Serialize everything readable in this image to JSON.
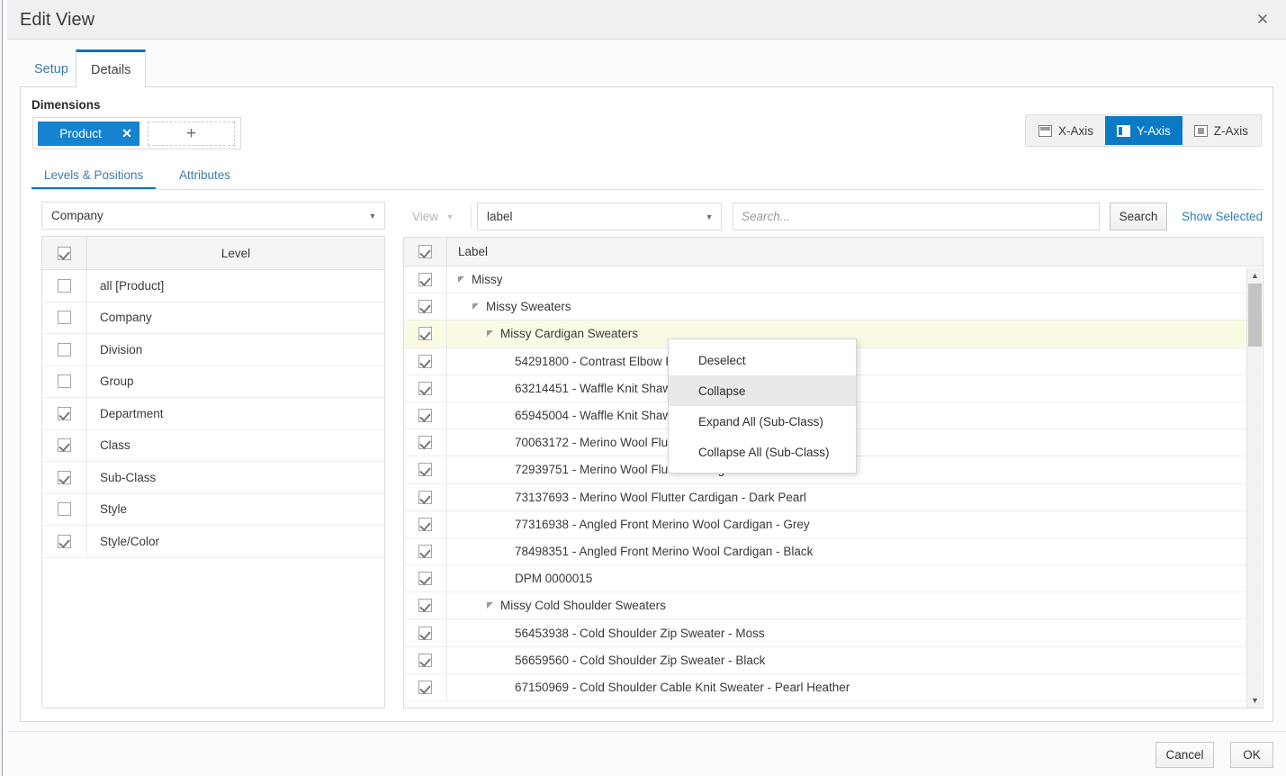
{
  "window": {
    "title": "Edit View",
    "close_icon": "close-icon"
  },
  "tabs": [
    {
      "label": "Setup",
      "active": false
    },
    {
      "label": "Details",
      "active": true
    }
  ],
  "dimensions": {
    "heading": "Dimensions",
    "pill": {
      "label": "Product",
      "remove_icon": "close-icon"
    },
    "add_icon": "plus-icon"
  },
  "axis_buttons": [
    {
      "label": "X-Axis",
      "icon": "x-axis-icon",
      "active": false
    },
    {
      "label": "Y-Axis",
      "icon": "y-axis-icon",
      "active": true
    },
    {
      "label": "Z-Axis",
      "icon": "z-axis-icon",
      "active": false
    }
  ],
  "subtabs": [
    {
      "label": "Levels & Positions",
      "active": true
    },
    {
      "label": "Attributes",
      "active": false
    }
  ],
  "levels_panel": {
    "hierarchy_selected": "Company",
    "column_header": "Level",
    "header_checkbox": true,
    "rows": [
      {
        "label": "all [Product]",
        "checked": false
      },
      {
        "label": "Company",
        "checked": false
      },
      {
        "label": "Division",
        "checked": false
      },
      {
        "label": "Group",
        "checked": false
      },
      {
        "label": "Department",
        "checked": true
      },
      {
        "label": "Class",
        "checked": true
      },
      {
        "label": "Sub-Class",
        "checked": true
      },
      {
        "label": "Style",
        "checked": false
      },
      {
        "label": "Style/Color",
        "checked": true
      }
    ]
  },
  "tree_panel": {
    "view_button": "View",
    "display_field": "label",
    "search_placeholder": "Search...",
    "search_value": "",
    "search_button": "Search",
    "show_selected_link": "Show Selected",
    "column_header": "Label",
    "header_checkbox": true,
    "rows": [
      {
        "label": "Missy",
        "checked": true,
        "indent": 0,
        "expander": true,
        "selected": false
      },
      {
        "label": "Missy Sweaters",
        "checked": true,
        "indent": 1,
        "expander": true,
        "selected": false
      },
      {
        "label": "Missy Cardigan Sweaters",
        "checked": true,
        "indent": 2,
        "expander": true,
        "selected": true
      },
      {
        "label": "54291800 - Contrast Elbow Patch Cardigan - Oatmeal",
        "checked": true,
        "indent": 3,
        "expander": false,
        "selected": false
      },
      {
        "label": "63214451 - Waffle Knit Shawl Collar Cardigan - Navy",
        "checked": true,
        "indent": 3,
        "expander": false,
        "selected": false
      },
      {
        "label": "65945004 - Waffle Knit Shawl Collar Cardigan - Grey",
        "checked": true,
        "indent": 3,
        "expander": false,
        "selected": false
      },
      {
        "label": "70063172 - Merino Wool Flutter Cardigan - Ivory",
        "checked": true,
        "indent": 3,
        "expander": false,
        "selected": false
      },
      {
        "label": "72939751 - Merino Wool Flutter Cardigan - China Red",
        "checked": true,
        "indent": 3,
        "expander": false,
        "selected": false
      },
      {
        "label": "73137693 - Merino Wool Flutter Cardigan - Dark Pearl",
        "checked": true,
        "indent": 3,
        "expander": false,
        "selected": false
      },
      {
        "label": "77316938 - Angled Front Merino Wool Cardigan - Grey",
        "checked": true,
        "indent": 3,
        "expander": false,
        "selected": false
      },
      {
        "label": "78498351 - Angled Front Merino Wool Cardigan - Black",
        "checked": true,
        "indent": 3,
        "expander": false,
        "selected": false
      },
      {
        "label": "DPM 0000015",
        "checked": true,
        "indent": 3,
        "expander": false,
        "selected": false
      },
      {
        "label": "Missy Cold Shoulder Sweaters",
        "checked": true,
        "indent": 2,
        "expander": true,
        "selected": false
      },
      {
        "label": "56453938 - Cold Shoulder Zip Sweater - Moss",
        "checked": true,
        "indent": 3,
        "expander": false,
        "selected": false
      },
      {
        "label": "56659560 - Cold Shoulder Zip Sweater - Black",
        "checked": true,
        "indent": 3,
        "expander": false,
        "selected": false
      },
      {
        "label": "67150969 - Cold Shoulder Cable Knit Sweater - Pearl Heather",
        "checked": true,
        "indent": 3,
        "expander": false,
        "selected": false
      }
    ],
    "scroll_up_icon": "chevron-up-icon",
    "scroll_down_icon": "chevron-down-icon"
  },
  "context_menu": {
    "items": [
      {
        "label": "Deselect",
        "highlighted": false
      },
      {
        "label": "Collapse",
        "highlighted": true
      },
      {
        "label": "Expand All (Sub-Class)",
        "highlighted": false
      },
      {
        "label": "Collapse All (Sub-Class)",
        "highlighted": false
      }
    ]
  },
  "footer": {
    "cancel": "Cancel",
    "ok": "OK"
  },
  "colors": {
    "accent": "#0a7ac4",
    "pill": "#1583d0",
    "link": "#2f7fb5",
    "selected_row": "#fbfae4"
  }
}
